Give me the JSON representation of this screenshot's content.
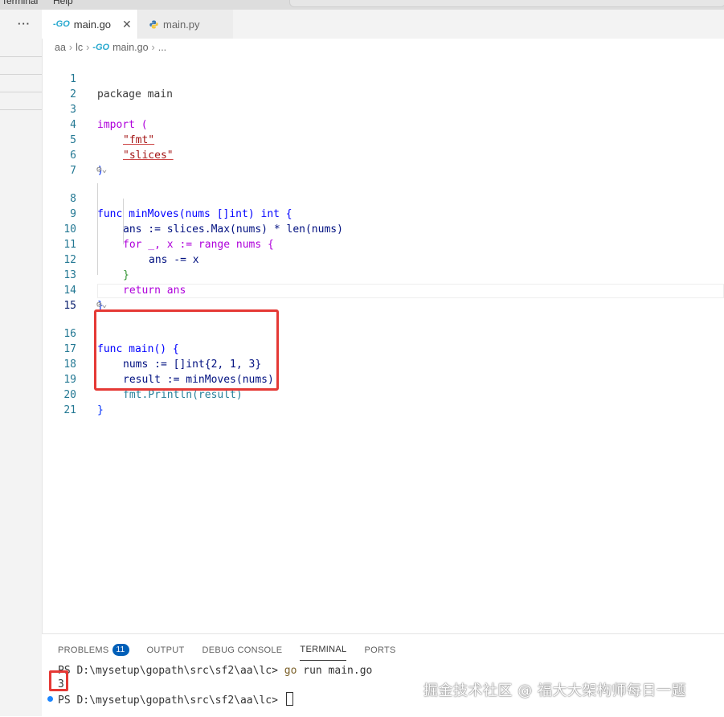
{
  "menubar": {
    "items": [
      "Terminal",
      "Help"
    ]
  },
  "sidebar": {
    "more_label": "···"
  },
  "tabs": [
    {
      "icon": "go-icon",
      "icon_text": "-GO",
      "label": "main.go",
      "active": true
    },
    {
      "icon": "python-icon",
      "label": "main.py",
      "active": false
    }
  ],
  "breadcrumb": {
    "parts": [
      "aa",
      "lc",
      "main.go",
      "..."
    ],
    "go_icon_text": "-GO"
  },
  "codelens_icon": "settings-gear-icon",
  "editor": {
    "lines": [
      {
        "n": "1",
        "text": "package main"
      },
      {
        "n": "2",
        "text": ""
      },
      {
        "n": "3",
        "text": "import ("
      },
      {
        "n": "4",
        "text": "\"fmt\""
      },
      {
        "n": "5",
        "text": "\"slices\""
      },
      {
        "n": "6",
        "text": ")"
      },
      {
        "n": "7",
        "text": ""
      },
      {
        "n": "8",
        "text": "func minMoves(nums []int) int {"
      },
      {
        "n": "9",
        "text": "ans := slices.Max(nums) * len(nums)"
      },
      {
        "n": "10",
        "text": "for _, x := range nums {"
      },
      {
        "n": "11",
        "text": "ans -= x"
      },
      {
        "n": "12",
        "text": "}"
      },
      {
        "n": "13",
        "text": "return ans"
      },
      {
        "n": "14",
        "text": "}"
      },
      {
        "n": "15",
        "text": ""
      },
      {
        "n": "16",
        "text": "func main() {"
      },
      {
        "n": "17",
        "text": "nums := []int{2, 1, 3}"
      },
      {
        "n": "18",
        "text": "result := minMoves(nums)"
      },
      {
        "n": "19",
        "text": "fmt.Println(result)"
      },
      {
        "n": "20",
        "text": "}"
      },
      {
        "n": "21",
        "text": ""
      }
    ]
  },
  "panel": {
    "tabs": [
      {
        "label": "PROBLEMS",
        "badge": "11"
      },
      {
        "label": "OUTPUT"
      },
      {
        "label": "DEBUG CONSOLE"
      },
      {
        "label": "TERMINAL",
        "active": true
      },
      {
        "label": "PORTS"
      }
    ],
    "terminal": {
      "prompt1": "PS D:\\mysetup\\gopath\\src\\sf2\\aa\\lc> ",
      "cmd_go": "go",
      "cmd_rest": " run main.go",
      "output": "3",
      "prompt2": "PS D:\\mysetup\\gopath\\src\\sf2\\aa\\lc> "
    }
  },
  "watermark": "掘金技术社区 @ 福大大架构师每日一题",
  "colors": {
    "accent": "#005fb8",
    "highlight_red": "#e53935",
    "go_blue": "#29a9cf"
  }
}
